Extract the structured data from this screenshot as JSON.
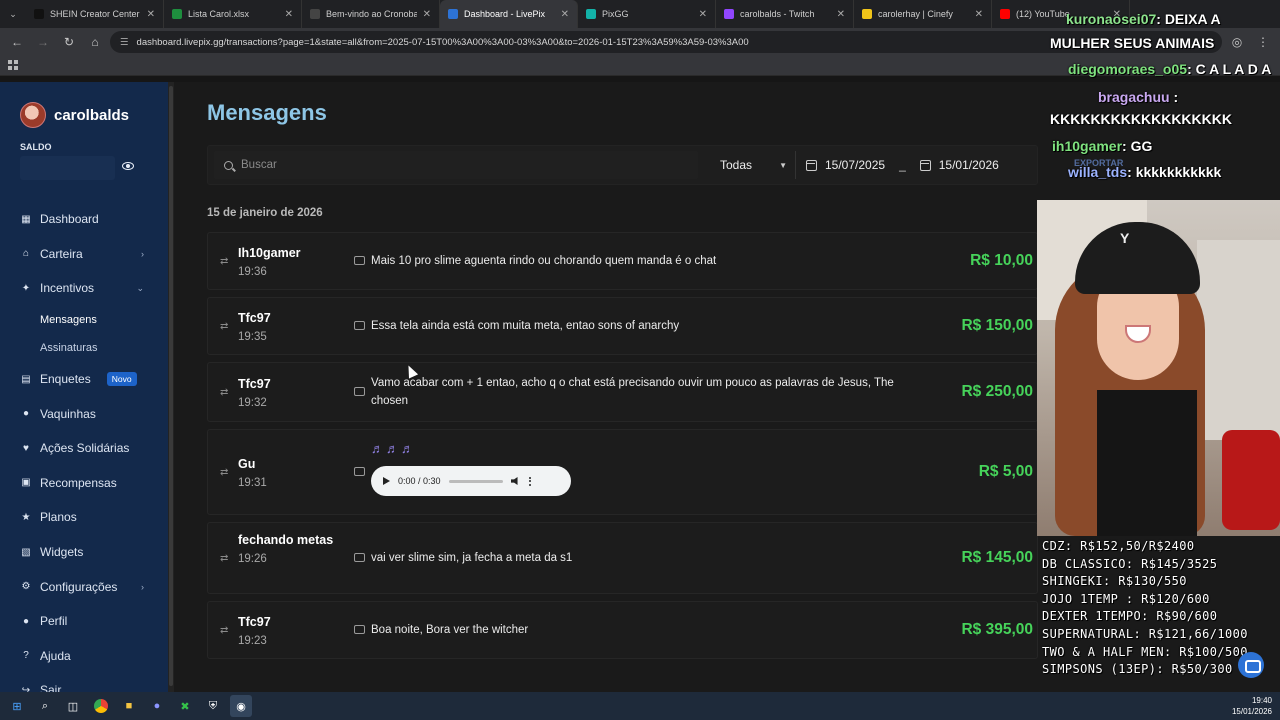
{
  "browser": {
    "tabs": [
      {
        "label": "SHEIN Creator Center",
        "color": "#111111"
      },
      {
        "label": "Lista Carol.xlsx",
        "color": "#1e8e3e"
      },
      {
        "label": "Bem-vindo ao Cronobalá",
        "color": "#444444"
      },
      {
        "label": "Dashboard - LivePix",
        "color": "#2d73d6",
        "active": true
      },
      {
        "label": "PixGG",
        "color": "#13b2a8"
      },
      {
        "label": "carolbalds - Twitch",
        "color": "#9146ff"
      },
      {
        "label": "carolerhay | Cinefy",
        "color": "#f0c419"
      },
      {
        "label": "(12) YouTube",
        "color": "#ff0000"
      }
    ],
    "url": "dashboard.livepix.gg/transactions?page=1&state=all&from=2025-07-15T00%3A00%3A00-03%3A00&to=2026-01-15T23%3A59%3A59-03%3A00"
  },
  "sidebar": {
    "username": "carolbalds",
    "saldo_label": "SALDO",
    "items": [
      {
        "label": "Dashboard",
        "icon": "grid-icon",
        "glyph": "▦"
      },
      {
        "label": "Carteira",
        "icon": "bank-icon",
        "glyph": "⌂",
        "chevron": "›"
      },
      {
        "label": "Incentivos",
        "icon": "sparkle-icon",
        "glyph": "✦",
        "chevron": "⌄"
      },
      {
        "label": "Mensagens",
        "sub": true,
        "active": true
      },
      {
        "label": "Assinaturas",
        "sub": true
      },
      {
        "label": "Enquetes",
        "icon": "poll-icon",
        "glyph": "▤",
        "badge": "Novo"
      },
      {
        "label": "Vaquinhas",
        "icon": "piggy-icon",
        "glyph": "●"
      },
      {
        "label": "Ações Solidárias",
        "icon": "heart-icon",
        "glyph": "♥"
      },
      {
        "label": "Recompensas",
        "icon": "gift-icon",
        "glyph": "▣"
      },
      {
        "label": "Planos",
        "icon": "star-icon",
        "glyph": "★"
      },
      {
        "label": "Widgets",
        "icon": "widget-icon",
        "glyph": "▧"
      },
      {
        "label": "Configurações",
        "icon": "gear-icon",
        "glyph": "⚙",
        "chevron": "›"
      },
      {
        "label": "Perfil",
        "icon": "user-icon",
        "glyph": "●"
      },
      {
        "label": "Ajuda",
        "icon": "help-icon",
        "glyph": "?"
      },
      {
        "label": "Sair",
        "icon": "logout-icon",
        "glyph": "↪"
      }
    ]
  },
  "main": {
    "title": "Mensagens",
    "search_placeholder": "Buscar",
    "filter_state": "Todas",
    "date_from": "15/07/2025",
    "date_separator": "_",
    "date_to": "15/01/2026",
    "day_label": "15 de janeiro de 2026",
    "rows": [
      {
        "name": "Ih10gamer",
        "time": "19:36",
        "message": "Mais 10 pro slime aguenta rindo ou chorando quem manda é o chat",
        "amount": "R$ 10,00"
      },
      {
        "name": "Tfc97",
        "time": "19:35",
        "message": "Essa tela ainda está com muita meta, entao sons of anarchy",
        "amount": "R$ 150,00"
      },
      {
        "name": "Tfc97",
        "time": "19:32",
        "message": "Vamo acabar com + 1 entao, acho q o chat está precisando ouvir um pouco as palavras de Jesus, The chosen",
        "amount": "R$ 250,00"
      },
      {
        "name": "Gu",
        "time": "19:31",
        "audio": true,
        "notes": "♬♬♬",
        "player_time": "0:00 / 0:30",
        "audio_progress": 0.0,
        "amount": "R$ 5,00"
      },
      {
        "name": "fechando metas",
        "time": "19:26",
        "message": "vai ver slime sim, ja fecha a meta da s1",
        "amount": "R$ 145,00"
      },
      {
        "name": "Tfc97",
        "time": "19:23",
        "message": "Boa noite, Bora ver the witcher",
        "amount": "R$ 395,00"
      }
    ]
  },
  "overlay": {
    "chat": [
      {
        "user": "kuronaosei07",
        "text": ": DEIXA A",
        "cls": "user-a",
        "style": "left:26px;top:5px;"
      },
      {
        "user": "",
        "text": "MULHER SEUS ANIMAIS",
        "cls": "",
        "style": "left:10px;top:29px;"
      },
      {
        "user": "diegomoraes_o05",
        "text": ": C A L A D A",
        "cls": "user-c",
        "style": "left:28px;top:55px;"
      },
      {
        "user": "bragachuu",
        "text": " :",
        "cls": "user-b",
        "style": "left:58px;top:83px;"
      },
      {
        "user": "",
        "text": "KKKKKKKKKKKKKKKKKK",
        "cls": "",
        "style": "left:10px;top:105px;"
      },
      {
        "user": "ih10gamer",
        "text": ": GG",
        "cls": "user-c",
        "style": "left:12px;top:132px;"
      },
      {
        "user": "willa_tds",
        "text": ": kkkkkkkkkkk",
        "cls": "user-d",
        "style": "left:28px;top:158px;"
      }
    ],
    "ghost_export": "EXPORTAR",
    "cap_text": "Y",
    "goals": [
      "CDZ: R$152,50/R$2400",
      "DB CLASSICO: R$145/3525",
      "SHINGEKI: R$130/550",
      "JOJO 1TEMP : R$120/600",
      "DEXTER 1TEMPO: R$90/600",
      "SUPERNATURAL: R$121,66/1000",
      "TWO & A HALF MEN: R$100/500",
      "SIMPSONS (13EP): R$50/300"
    ]
  },
  "taskbar": {
    "time": "19:40",
    "date": "15/01/2026"
  }
}
